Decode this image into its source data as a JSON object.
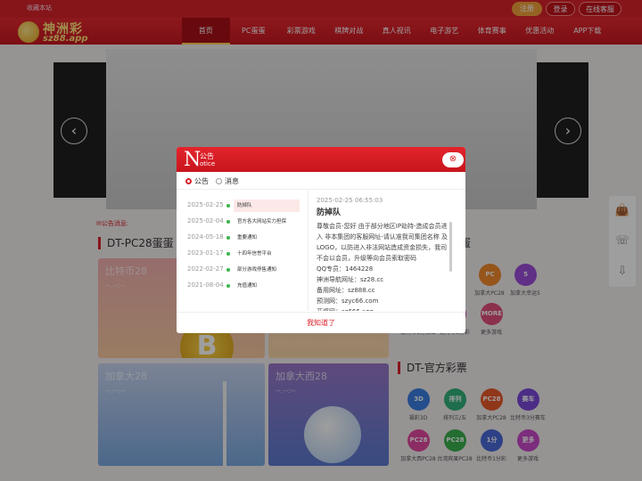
{
  "header": {
    "favorite": "收藏本站",
    "register": "注册",
    "login": "登录",
    "service": "在线客服",
    "logo_cn": "神洲彩",
    "logo_en": "sz88.app"
  },
  "nav": [
    "首页",
    "PC蛋蛋",
    "彩票游戏",
    "棋牌对战",
    "真人视讯",
    "电子游艺",
    "体育赛事",
    "优惠活动",
    "APP下载"
  ],
  "announce_label": "公告消息:",
  "sections": {
    "pc28_title": "DT-PC28蛋蛋",
    "right_title_cut": "蛋",
    "official_title": "DT-官方彩票"
  },
  "cards": [
    {
      "title": "比特币28",
      "sub": "--.--:--"
    },
    {
      "title": "加拿大28",
      "sub": "--.--:--"
    },
    {
      "title": "加拿大西28",
      "sub": "--.--:--"
    }
  ],
  "coin_symbol": "B",
  "pc28_games": [
    {
      "label": "加拿大PC28",
      "icon": "PC",
      "color": "#f08a2c"
    },
    {
      "label": "加拿大幸运5",
      "icon": "5",
      "color": "#9b4dd8"
    },
    {
      "label": "比特币1分赛车",
      "icon": "",
      "color": "#3a9de0"
    },
    {
      "label": "比特币3分彩",
      "icon": "B",
      "color": "#c03ca0"
    },
    {
      "label": "更多游戏",
      "icon": "MORE",
      "color": "#e0507a"
    }
  ],
  "official_games": [
    {
      "label": "福彩3D",
      "icon": "3D",
      "color": "#3a7de0"
    },
    {
      "label": "排列三/五",
      "icon": "排列",
      "color": "#32b07a"
    },
    {
      "label": "加拿大PC28",
      "icon": "PC28",
      "color": "#e85a2a"
    },
    {
      "label": "比特币3分赛车",
      "icon": "赛车",
      "color": "#7a4ad8"
    },
    {
      "label": "加拿大西PC28",
      "icon": "PC28",
      "color": "#e04aa0"
    },
    {
      "label": "台湾宾果PC28",
      "icon": "PC28",
      "color": "#3ab050"
    },
    {
      "label": "比特币1分彩",
      "icon": "1分",
      "color": "#4a6ad8"
    },
    {
      "label": "更多游戏",
      "icon": "更多",
      "color": "#c84ac8"
    }
  ],
  "modal": {
    "logo_letter": "N",
    "title_cn": "公告",
    "title_en": "otice",
    "close": "⊗",
    "tab_notice": "公告",
    "tab_message": "消息",
    "list": [
      {
        "date": "2025-02-25",
        "title": "防掉队"
      },
      {
        "date": "2025-02-04",
        "title": "官方各大网站实力担保"
      },
      {
        "date": "2024-05-18",
        "title": "重要通知"
      },
      {
        "date": "2023-01-17",
        "title": "十四年信誉平台"
      },
      {
        "date": "2022-02-27",
        "title": "部分游戏停售通知"
      },
      {
        "date": "2021-08-04",
        "title": "充值通知"
      }
    ],
    "content_date": "2025-02-25 06:55:03",
    "content_title": "防掉队",
    "content_lines": [
      "尊敬会员-您好 由于部分地区IP劫持-造成会员进入 非本集团的客服网址-请认准我司集团名称 及LOGO，以防进入非法网站造成资金损失，我司不会以会员，升级等向会员索取密码",
      "QQ专员：1464228",
      "神洲导航网址：sz28.cc",
      "备用网址：sz888.cc",
      "预测网：szyc66.com",
      "开奖网：sz666.app"
    ],
    "footer": "我知道了"
  }
}
